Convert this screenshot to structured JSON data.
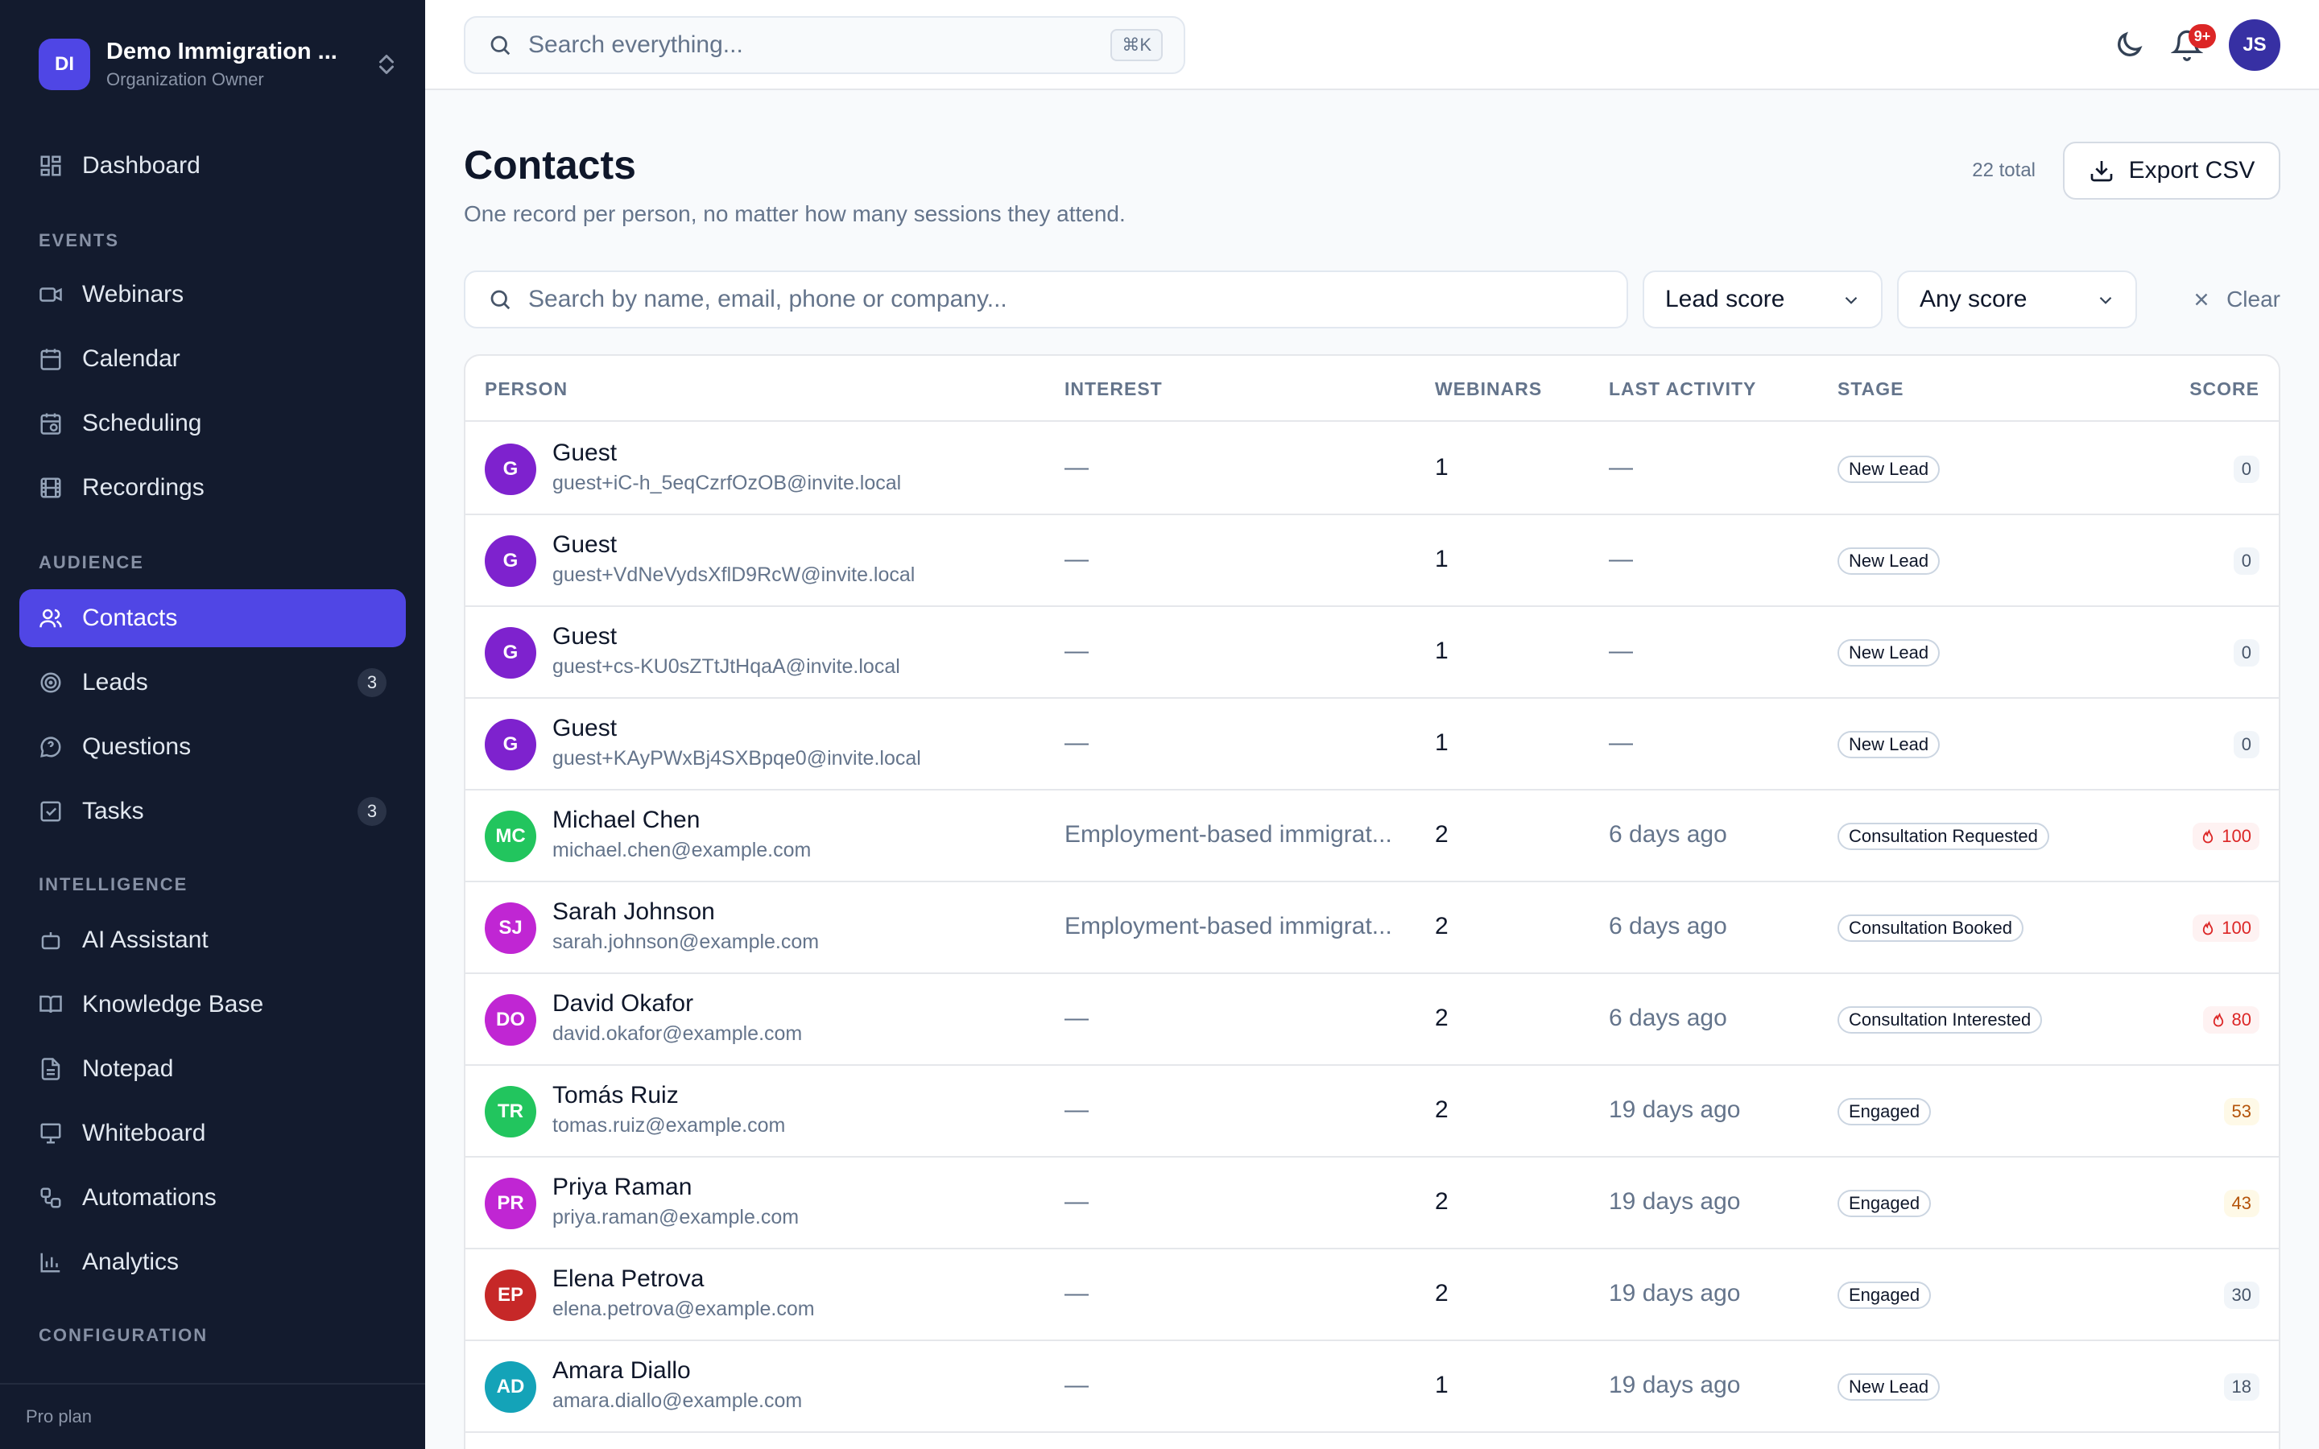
{
  "org": {
    "initials": "DI",
    "name": "Demo Immigration ...",
    "role": "Organization Owner"
  },
  "nav": {
    "dashboard": "Dashboard",
    "sections": {
      "events": "Events",
      "audience": "Audience",
      "intelligence": "Intelligence",
      "configuration": "Configuration"
    },
    "items": {
      "webinars": "Webinars",
      "calendar": "Calendar",
      "scheduling": "Scheduling",
      "recordings": "Recordings",
      "contacts": "Contacts",
      "leads": "Leads",
      "leads_count": "3",
      "questions": "Questions",
      "tasks": "Tasks",
      "tasks_count": "3",
      "ai_assistant": "AI Assistant",
      "knowledge_base": "Knowledge Base",
      "notepad": "Notepad",
      "whiteboard": "Whiteboard",
      "automations": "Automations",
      "analytics": "Analytics"
    },
    "plan": "Pro plan"
  },
  "topbar": {
    "search_placeholder": "Search everything...",
    "shortcut": "⌘K",
    "notif_badge": "9+",
    "user_initials": "JS"
  },
  "page": {
    "title": "Contacts",
    "subtitle": "One record per person, no matter how many sessions they attend.",
    "total": "22 total",
    "export_label": "Export CSV"
  },
  "filters": {
    "search_placeholder": "Search by name, email, phone or company...",
    "sort": "Lead score",
    "score": "Any score",
    "clear": "Clear"
  },
  "table": {
    "headers": {
      "person": "Person",
      "interest": "Interest",
      "webinars": "Webinars",
      "last_activity": "Last activity",
      "stage": "Stage",
      "score": "Score"
    },
    "rows": [
      {
        "initials": "G",
        "color": "#7e22ce",
        "name": "Guest",
        "email": "guest+iC-h_5eqCzrfOzOB@invite.local",
        "interest": "—",
        "webinars": "1",
        "last": "—",
        "stage": "New Lead",
        "score": "0",
        "score_style": "gray"
      },
      {
        "initials": "G",
        "color": "#7e22ce",
        "name": "Guest",
        "email": "guest+VdNeVydsXflD9RcW@invite.local",
        "interest": "—",
        "webinars": "1",
        "last": "—",
        "stage": "New Lead",
        "score": "0",
        "score_style": "gray"
      },
      {
        "initials": "G",
        "color": "#7e22ce",
        "name": "Guest",
        "email": "guest+cs-KU0sZTtJtHqaA@invite.local",
        "interest": "—",
        "webinars": "1",
        "last": "—",
        "stage": "New Lead",
        "score": "0",
        "score_style": "gray"
      },
      {
        "initials": "G",
        "color": "#7e22ce",
        "name": "Guest",
        "email": "guest+KAyPWxBj4SXBpqe0@invite.local",
        "interest": "—",
        "webinars": "1",
        "last": "—",
        "stage": "New Lead",
        "score": "0",
        "score_style": "gray"
      },
      {
        "initials": "MC",
        "color": "#22c55e",
        "name": "Michael Chen",
        "email": "michael.chen@example.com",
        "interest": "Employment-based immigrat...",
        "webinars": "2",
        "last": "6 days ago",
        "stage": "Consultation Requested",
        "score": "100",
        "score_style": "hot"
      },
      {
        "initials": "SJ",
        "color": "#c026d3",
        "name": "Sarah Johnson",
        "email": "sarah.johnson@example.com",
        "interest": "Employment-based immigrat...",
        "webinars": "2",
        "last": "6 days ago",
        "stage": "Consultation Booked",
        "score": "100",
        "score_style": "hot"
      },
      {
        "initials": "DO",
        "color": "#c026d3",
        "name": "David Okafor",
        "email": "david.okafor@example.com",
        "interest": "—",
        "webinars": "2",
        "last": "6 days ago",
        "stage": "Consultation Interested",
        "score": "80",
        "score_style": "hot"
      },
      {
        "initials": "TR",
        "color": "#22c55e",
        "name": "Tomás Ruiz",
        "email": "tomas.ruiz@example.com",
        "interest": "—",
        "webinars": "2",
        "last": "19 days ago",
        "stage": "Engaged",
        "score": "53",
        "score_style": "warm"
      },
      {
        "initials": "PR",
        "color": "#c026d3",
        "name": "Priya Raman",
        "email": "priya.raman@example.com",
        "interest": "—",
        "webinars": "2",
        "last": "19 days ago",
        "stage": "Engaged",
        "score": "43",
        "score_style": "warm"
      },
      {
        "initials": "EP",
        "color": "#c62828",
        "name": "Elena Petrova",
        "email": "elena.petrova@example.com",
        "interest": "—",
        "webinars": "2",
        "last": "19 days ago",
        "stage": "Engaged",
        "score": "30",
        "score_style": "gray"
      },
      {
        "initials": "AD",
        "color": "#14a3b8",
        "name": "Amara Diallo",
        "email": "amara.diallo@example.com",
        "interest": "—",
        "webinars": "1",
        "last": "19 days ago",
        "stage": "New Lead",
        "score": "18",
        "score_style": "gray"
      }
    ]
  }
}
